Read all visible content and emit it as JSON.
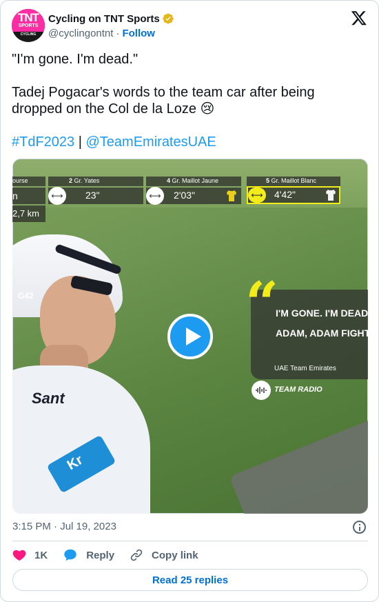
{
  "author": {
    "display_name": "Cycling on TNT Sports",
    "handle": "@cyclingontnt",
    "separator": "·",
    "follow_label": "Follow",
    "avatar_text": {
      "line1": "TNT",
      "line2": "SPORTS",
      "line3": "CYCLING"
    }
  },
  "tweet": {
    "line1": "\"I'm gone. I'm dead.\"",
    "line2": "Tadej Pogacar's words to the team car after being dropped on the Col de la Loze 😢",
    "hashtag": "#TdF2023",
    "pipe": "|",
    "mention": "@TeamEmiratesUAE"
  },
  "video": {
    "overlay": {
      "course_label": "ourse",
      "course_value": "n",
      "distance": "2,7 km",
      "rider1_rank": "2",
      "rider1_label": "Gr. Yates",
      "rider1_gap": "23\"",
      "rider2_rank": "4",
      "rider2_label": "Gr. Maillot Jaune",
      "rider2_gap": "2'03\"",
      "rider3_rank": "5",
      "rider3_label": "Gr. Maillot Blanc",
      "rider3_gap": "4'42\"",
      "quote_line1": "I'M GONE. I'M DEAD",
      "quote_line2": "ADAM, ADAM FIGHT",
      "team": "UAE Team Emirates",
      "radio_label": "TEAM RADIO",
      "jersey_text": "Sant",
      "sleeve_text": "Kr",
      "helmet_text": "G42"
    },
    "colors": {
      "accent": "#f2ec1b",
      "play": "#1d9bf0"
    }
  },
  "meta": {
    "timestamp": "3:15 PM · Jul 19, 2023"
  },
  "actions": {
    "likes_count": "1K",
    "reply_label": "Reply",
    "copy_link_label": "Copy link"
  },
  "read_replies_label": "Read 25 replies"
}
